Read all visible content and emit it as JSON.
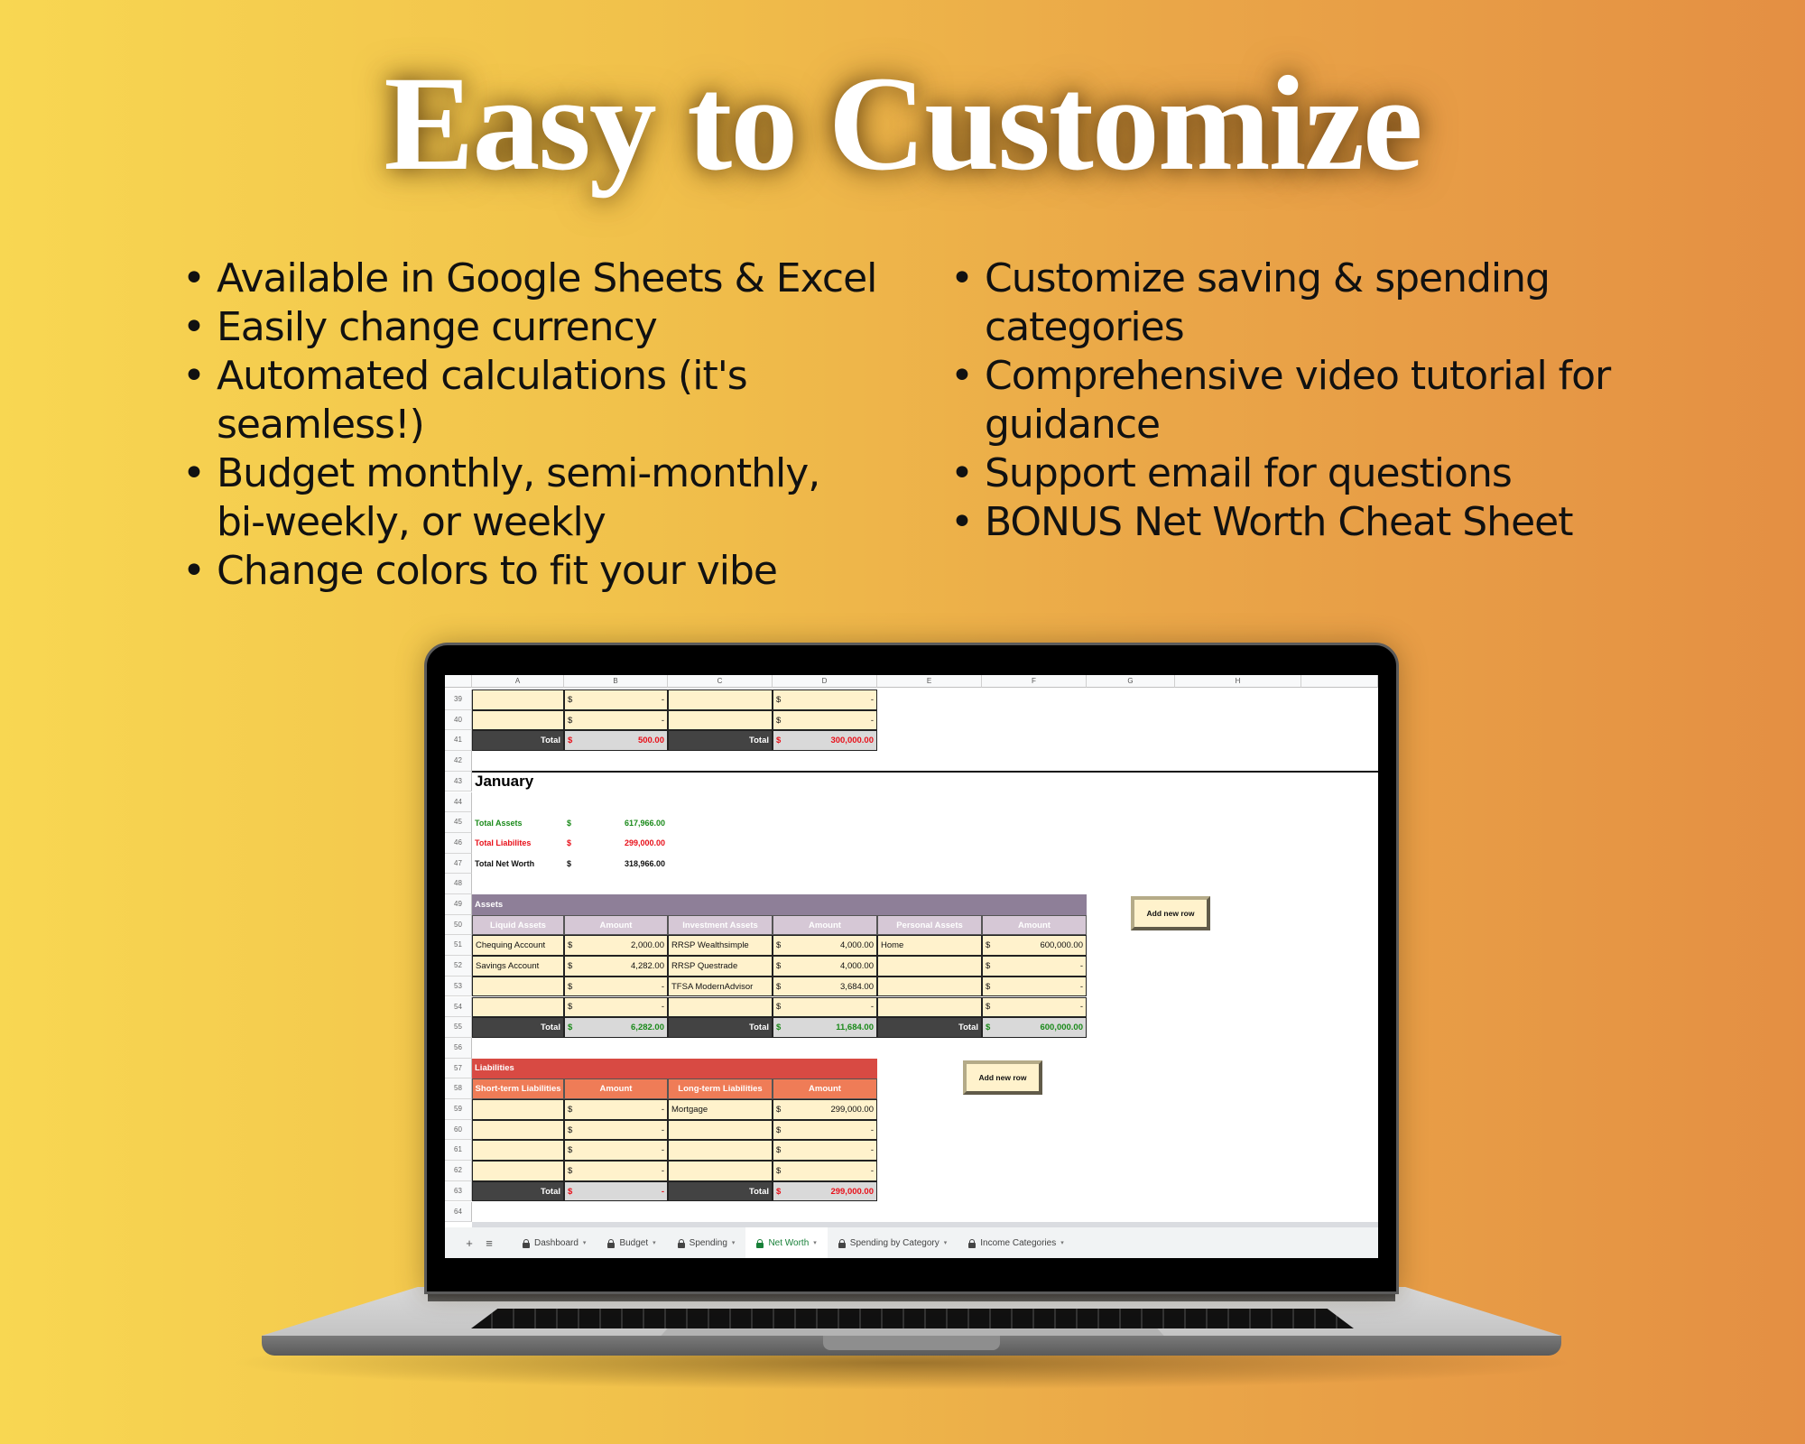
{
  "headline": "Easy to Customize",
  "features_left": [
    "Available in Google Sheets & Excel",
    "Easily change currency",
    "Automated calculations (it's seamless!)",
    "Budget monthly, semi-monthly, bi-weekly, or weekly",
    "Change colors to fit your vibe"
  ],
  "features_right": [
    "Customize saving & spending categories",
    "Comprehensive video tutorial for guidance",
    "Support email for questions",
    "BONUS Net Worth Cheat Sheet"
  ],
  "bullet": "•",
  "spreadsheet": {
    "columns": [
      "A",
      "B",
      "C",
      "D",
      "E",
      "F",
      "G",
      "H"
    ],
    "rows": [
      "39",
      "40",
      "41",
      "42",
      "43",
      "44",
      "45",
      "46",
      "47",
      "48",
      "49",
      "50",
      "51",
      "52",
      "53",
      "54",
      "55",
      "56",
      "57",
      "58",
      "59",
      "60",
      "61",
      "62",
      "63",
      "64"
    ],
    "currency": "$",
    "dash": "-",
    "total_label": "Total",
    "top_block": {
      "total_b": "500.00",
      "total_d": "300,000.00"
    },
    "month": "January",
    "summary": {
      "assets_label": "Total Assets",
      "assets_value": "617,966.00",
      "liabilities_label": "Total Liabilites",
      "liabilities_value": "299,000.00",
      "net_worth_label": "Total Net Worth",
      "net_worth_value": "318,966.00"
    },
    "assets": {
      "title": "Assets",
      "headers": [
        "Liquid Assets",
        "Amount",
        "Investment Assets",
        "Amount",
        "Personal Assets",
        "Amount"
      ],
      "rows": [
        [
          "Chequing Account",
          "2,000.00",
          "RRSP Wealthsimple",
          "4,000.00",
          "Home",
          "600,000.00"
        ],
        [
          "Savings Account",
          "4,282.00",
          "RRSP Questrade",
          "4,000.00",
          "",
          "-"
        ],
        [
          "",
          "-",
          "TFSA ModernAdvisor",
          "3,684.00",
          "",
          "-"
        ],
        [
          "",
          "-",
          "",
          "-",
          "",
          "-"
        ]
      ],
      "totals": [
        "6,282.00",
        "11,684.00",
        "600,000.00"
      ]
    },
    "liabilities": {
      "title": "Liabilities",
      "headers": [
        "Short-term Liabilities",
        "Amount",
        "Long-term Liabilities",
        "Amount"
      ],
      "rows": [
        [
          "",
          "-",
          "Mortgage",
          "299,000.00"
        ],
        [
          "",
          "-",
          "",
          "-"
        ],
        [
          "",
          "-",
          "",
          "-"
        ],
        [
          "",
          "-",
          "",
          "-"
        ]
      ],
      "totals": [
        "-",
        "299,000.00"
      ]
    },
    "add_row_button": "Add new row"
  },
  "sheet_tabs": {
    "add_icon": "+",
    "menu_icon": "≡",
    "caret": "▾",
    "tabs": [
      "Dashboard",
      "Budget",
      "Spending",
      "Net Worth",
      "Spending by Category",
      "Income Categories"
    ],
    "active": "Net Worth"
  },
  "colors": {
    "assets_header": "#8e7f98",
    "assets_subheader": "#d6c8d6",
    "liabilities_header": "#d84a43",
    "liabilities_subheader": "#ef7c57",
    "cell_fill": "#fff2cc",
    "total_fill": "#434343",
    "positive": "#1a8a1a",
    "negative": "#e8101a",
    "active_tab": "#188038"
  }
}
